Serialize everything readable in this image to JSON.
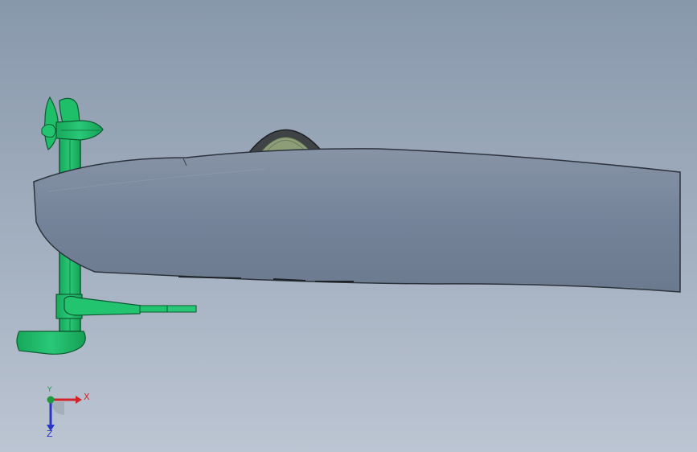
{
  "viewport": {
    "colors": {
      "background_top": "#8898ab",
      "background_bottom": "#bcc5d2",
      "hull": "#7a889b",
      "hull_edge": "#2c333c",
      "motor": "#1fbf6a",
      "motor_edge": "#0c5a30",
      "tire": "#3f4346",
      "hub": "#8c9d78"
    }
  },
  "model": {
    "parts": [
      "hull",
      "seat-ring",
      "propeller",
      "motor-pod",
      "motor-shaft",
      "tiller",
      "skeg"
    ]
  },
  "triad": {
    "x_label": "X",
    "y_label": "Y",
    "z_label": "Z",
    "x_color": "#d0262b",
    "y_color": "#1e9a3e",
    "z_color": "#2a35c8"
  }
}
